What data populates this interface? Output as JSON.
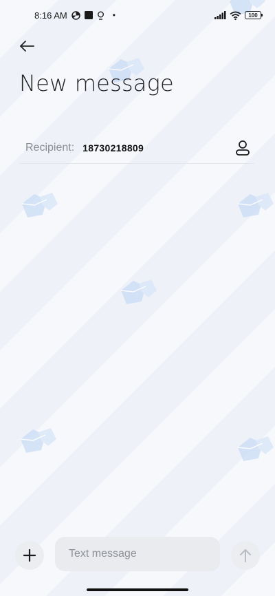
{
  "status_bar": {
    "time": "8:16 AM",
    "battery": "100",
    "dot": "•"
  },
  "header": {
    "title": "New message"
  },
  "recipient": {
    "label": "Recipient:",
    "value": "18730218809"
  },
  "composer": {
    "placeholder": "Text message"
  },
  "icons": {
    "back": "arrow-left-icon",
    "contact": "person-icon",
    "add": "plus-icon",
    "send": "arrow-up-icon"
  },
  "colors": {
    "background": "#f7f8fc",
    "input_bg": "#e9ebef",
    "muted_text": "#8a8d93",
    "watermark": "#c9dcf5"
  }
}
